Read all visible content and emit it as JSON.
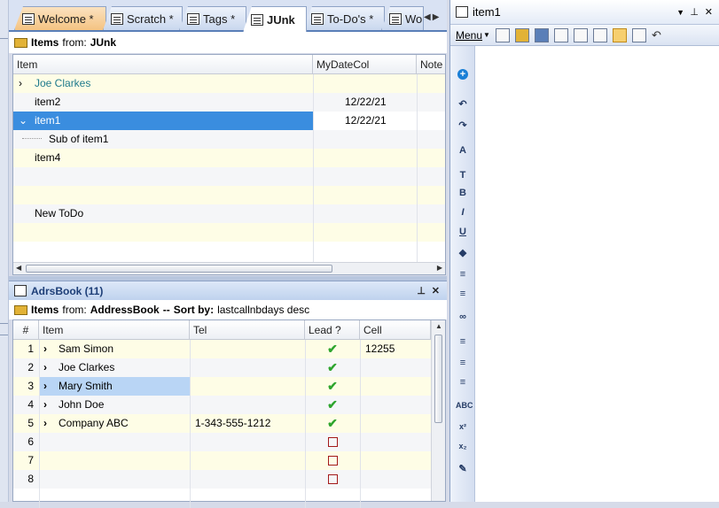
{
  "tabs": [
    {
      "label": "Welcome *"
    },
    {
      "label": "Scratch *"
    },
    {
      "label": "Tags *"
    },
    {
      "label": "JUnk"
    },
    {
      "label": "To-Do's *"
    },
    {
      "label": "Wo"
    }
  ],
  "items_header": {
    "prefix": "Items",
    "from_label": "from:",
    "source": "JUnk"
  },
  "top_grid": {
    "columns": [
      "Item",
      "MyDateCol",
      "Note"
    ],
    "rows": [
      {
        "item": "Joe Clarkes",
        "date": "",
        "child": false,
        "expand": "›"
      },
      {
        "item": "item2",
        "date": "12/22/21",
        "child": false,
        "expand": ""
      },
      {
        "item": "item1",
        "date": "12/22/21",
        "child": false,
        "expand": "⌄"
      },
      {
        "item": "Sub of item1",
        "date": "",
        "child": true,
        "expand": ""
      },
      {
        "item": "item4",
        "date": "",
        "child": false,
        "expand": ""
      },
      {
        "item": "",
        "date": "",
        "child": false,
        "expand": ""
      },
      {
        "item": "",
        "date": "",
        "child": false,
        "expand": ""
      },
      {
        "item": "New  ToDo",
        "date": "",
        "child": false,
        "expand": ""
      },
      {
        "item": "",
        "date": "",
        "child": false,
        "expand": ""
      }
    ]
  },
  "adrs": {
    "title": "AdrsBook (11)",
    "pin": "⊥",
    "close": "✕",
    "header": {
      "prefix": "Items",
      "from_label": "from:",
      "source": "AddressBook",
      "sep": "--",
      "sort_label": "Sort by:",
      "sort_value": "lastcallnbdays desc"
    },
    "columns": [
      "#",
      "Item",
      "Tel",
      "Lead ?",
      "Cell"
    ],
    "rows": [
      {
        "num": "1",
        "item": "Sam Simon",
        "tel": "",
        "lead": true,
        "cell": "12255"
      },
      {
        "num": "2",
        "item": "Joe Clarkes",
        "tel": "",
        "lead": true,
        "cell": ""
      },
      {
        "num": "3",
        "item": "Mary Smith",
        "tel": "",
        "lead": true,
        "cell": ""
      },
      {
        "num": "4",
        "item": "John Doe",
        "tel": "",
        "lead": true,
        "cell": ""
      },
      {
        "num": "5",
        "item": "Company ABC",
        "tel": "1-343-555-1212",
        "lead": true,
        "cell": ""
      },
      {
        "num": "6",
        "item": "",
        "tel": "",
        "lead": false,
        "cell": ""
      },
      {
        "num": "7",
        "item": "",
        "tel": "",
        "lead": false,
        "cell": ""
      },
      {
        "num": "8",
        "item": "",
        "tel": "",
        "lead": false,
        "cell": ""
      }
    ]
  },
  "right": {
    "title": "item1",
    "pin": "⊥",
    "close": "✕",
    "menu_label": "Menu",
    "vtools": [
      "+",
      "↶",
      "↷",
      "A",
      "T",
      "B",
      "I",
      "U",
      "◆",
      "≡",
      "≡",
      "∞",
      "≡",
      "≡",
      "≡",
      "ABC",
      "x²",
      "x₂",
      "✎"
    ]
  },
  "colors": {
    "accent": "#5a7fb8",
    "selected_row": "#3a8ddf",
    "selected_cell": "#b9d5f5",
    "row_alt": "#fefde6",
    "teal_text": "#1f7a8c"
  }
}
